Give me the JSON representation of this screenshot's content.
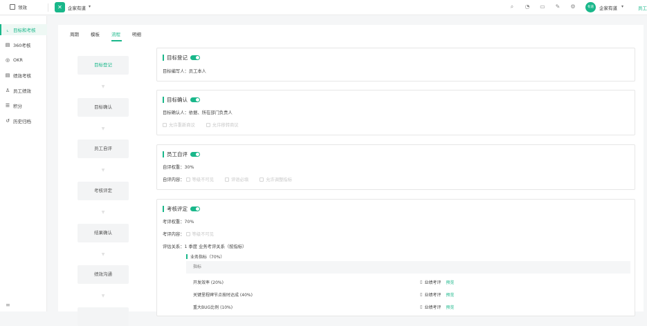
{
  "topbar": {
    "home_label": "领效",
    "company": "企家有道",
    "user_avatar_text": "有道",
    "user_name": "企家有道",
    "staff_link": "员工"
  },
  "sidebar": {
    "items": [
      {
        "label": "目标和考核",
        "icon": "chart-line-icon",
        "active": true
      },
      {
        "label": "360考核",
        "icon": "document-icon"
      },
      {
        "label": "OKR",
        "icon": "target-icon"
      },
      {
        "label": "绩效考核",
        "icon": "list-icon"
      },
      {
        "label": "员工绩效",
        "icon": "user-icon"
      },
      {
        "label": "积分",
        "icon": "database-icon"
      },
      {
        "label": "历史归档",
        "icon": "history-icon"
      }
    ]
  },
  "tabs": [
    "周期",
    "模板",
    "流程",
    "明细"
  ],
  "active_tab": "流程",
  "steps": [
    "目标登记",
    "目标确认",
    "员工自评",
    "考核评定",
    "结果确认",
    "绩效沟通"
  ],
  "cards": {
    "register": {
      "title": "目标登记",
      "editor": "目标编写人：员工本人"
    },
    "confirm": {
      "title": "目标确认",
      "confirmer": "目标确认人：依据、所在部门负责人",
      "opt1": "允许重新商议",
      "opt2": "允许移转商议"
    },
    "self": {
      "title": "员工自评",
      "weight": "自评权重：30%",
      "content_label": "自评内容：",
      "opt1": "等级不可见",
      "opt2": "评语必填",
      "opt3": "允许调整指标"
    },
    "review": {
      "title": "考核评定",
      "weight": "考评权重：70%",
      "content_label": "考评内容：",
      "opt1": "等级不可见",
      "relation": "评估关系：1 季度 业务考评关系（按指标）",
      "group": "业务指标（70%）",
      "header": "指标",
      "rows": [
        {
          "name": "开发效率 (20%)",
          "role": "业绩考评",
          "action": "预览"
        },
        {
          "name": "关键里程碑节点按时达成 (40%)",
          "role": "业绩考评",
          "action": "预览"
        },
        {
          "name": "重大BUG比例 (10%)",
          "role": "业绩考评",
          "action": "预览"
        }
      ]
    }
  },
  "colors": {
    "accent": "#19b78a"
  }
}
